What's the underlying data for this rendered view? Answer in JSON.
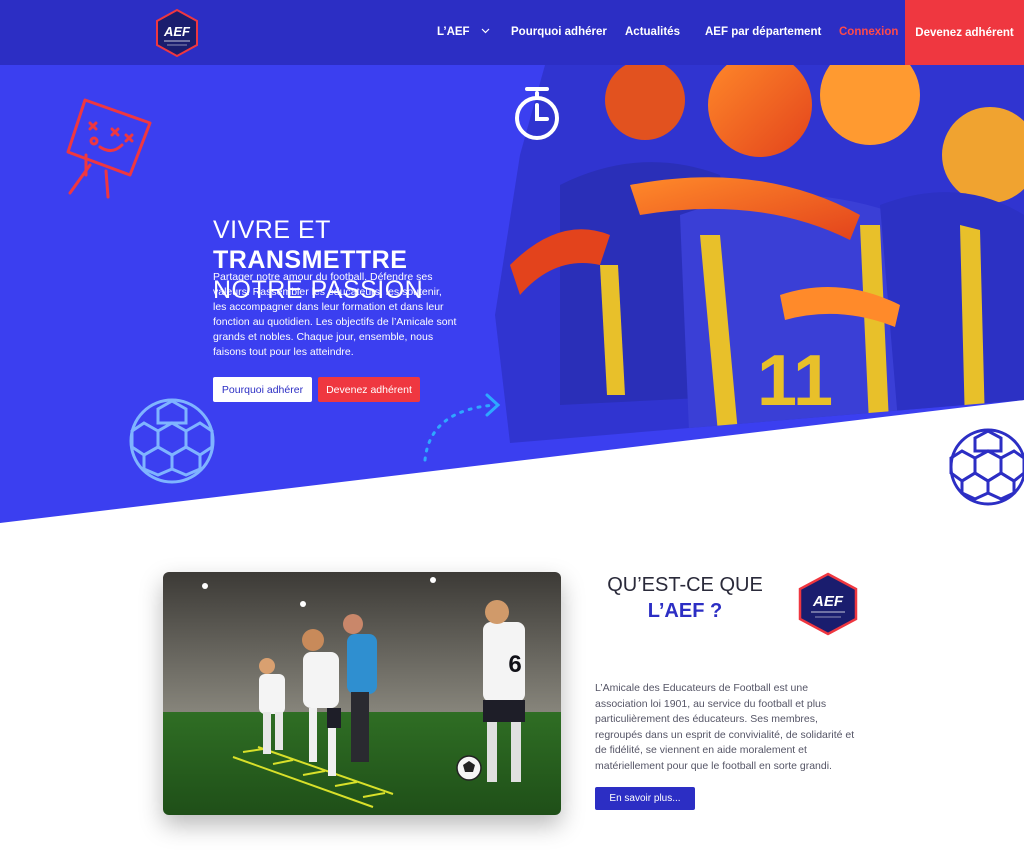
{
  "nav": {
    "items": [
      {
        "label": "L’AEF",
        "has_dropdown": true
      },
      {
        "label": "Pourquoi adhérer"
      },
      {
        "label": "Actualités"
      },
      {
        "label": "AEF par département"
      },
      {
        "label": "Connexion"
      }
    ],
    "cta": "Devenez adhérent",
    "logo_text": "AEF"
  },
  "hero": {
    "title_line1": "VIVRE ET",
    "title_line2": "TRANSMETTRE",
    "title_line3": "NOTRE PASSION",
    "text": "Partager notre amour du football. Défendre ses valeurs. Rassembler les éducateurs, les soutenir, les accompagner dans leur formation et dans leur fonction au quotidien. Les objectifs de l’Amicale sont grands et nobles. Chaque jour, ensemble, nous faisons tout pour les atteindre.",
    "btn_primary": "Pourquoi adhérer",
    "btn_secondary": "Devenez adhérent",
    "jersey_number": "11"
  },
  "about": {
    "title_line1": "QU’EST-CE QUE",
    "title_line2": "L’AEF ?",
    "text": "L’Amicale des Educateurs de Football est une association loi 1901, au service du football et plus particulièrement des éducateurs. Ses membres, regroupés dans un esprit de convivialité, de solidarité et de fidélité, se viennent en aide moralement et matériellement pour que le football en sorte grandi.",
    "button": "En savoir plus...",
    "logo_text": "AEF",
    "jersey_number": "6"
  },
  "colors": {
    "primary": "#2c2ec4",
    "accent": "#ef3740",
    "hero_blue": "#3b3ff0"
  }
}
